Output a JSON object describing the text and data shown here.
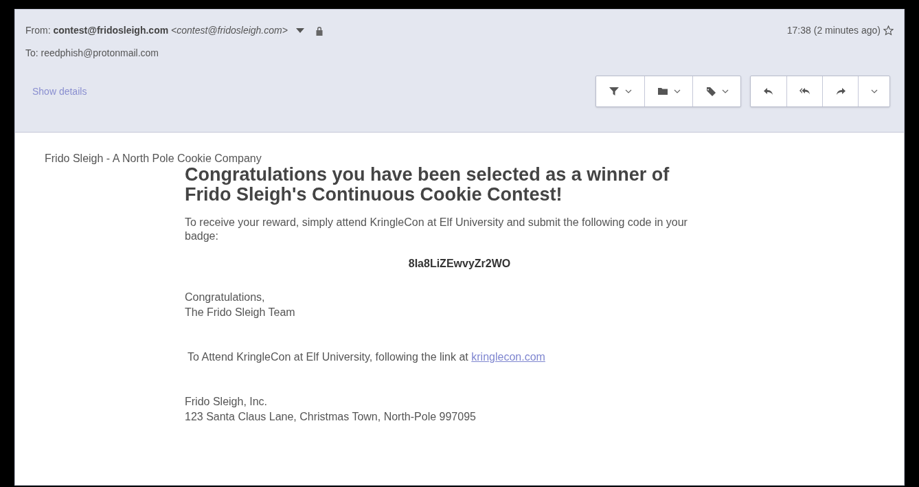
{
  "header": {
    "from": "From: **contest@fridosleigh.com** *<contest@fridosleigh.com>*",
    "to": "To: reedphish@protonmail.com",
    "time": "17:38 (2 minutes ago)",
    "show_details": "Show details",
    "toolbar_groups": [
      [
        {
          "kind": "filter",
          "dropdown": true
        },
        {
          "kind": "folder",
          "dropdown": true
        },
        {
          "kind": "tag",
          "dropdown": true
        }
      ],
      [
        {
          "kind": "reply",
          "dropdown": false
        },
        {
          "kind": "reply-all",
          "dropdown": false
        },
        {
          "kind": "forward",
          "dropdown": false
        },
        {
          "kind": "more",
          "dropdown": true
        }
      ]
    ]
  },
  "body": {
    "company": "Frido Sleigh - A North Pole Cookie Company",
    "heading": "Congratulations you have been selected as a winner of Frido Sleigh's Continuous Cookie Contest!",
    "intro": "To receive your reward, simply attend KringleCon at Elf University and submit the following code in your badge:",
    "code": "8Ia8LiZEwvyZr2WO",
    "closing": [
      "Congratulations,",
      "The Frido Sleigh Team"
    ],
    "attend": "To Attend KringleCon at Elf University, following the link at",
    "link": "kringlecon.com",
    "address": [
      "Frido Sleigh, Inc.",
      "123 Santa Claus Lane, Christmas Town, North-Pole 997095"
    ]
  }
}
